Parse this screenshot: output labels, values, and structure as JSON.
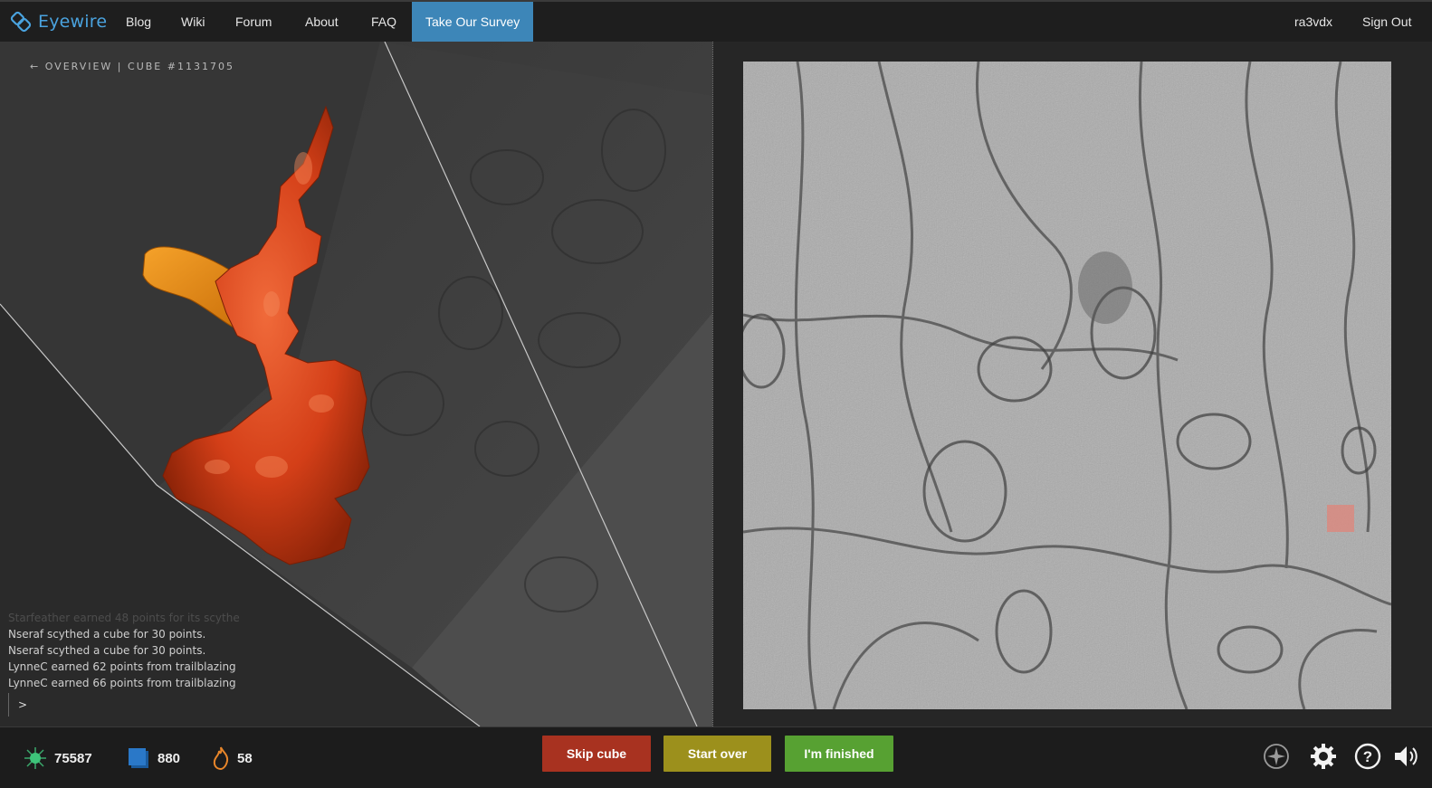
{
  "nav": {
    "logo_text": "Eyewire",
    "links": [
      "Blog",
      "Wiki",
      "Forum",
      "About",
      "FAQ",
      "Take Our Survey"
    ],
    "username": "ra3vdx",
    "signout": "Sign Out"
  },
  "viewer": {
    "back_arrow": "←",
    "overview": "OVERVIEW",
    "separator": "|",
    "cube_label": "CUBE #1131705"
  },
  "chat": {
    "faded_line": "Starfeather earned 48 points for its scythe",
    "messages": [
      "Nseraf scythed a cube for 30 points.",
      "Nseraf scythed a cube for 30 points.",
      "LynneC earned 62 points from trailblazing",
      "LynneC earned 66 points from trailblazing"
    ],
    "prompt": ">"
  },
  "stats": {
    "points": "75587",
    "cubes": "880",
    "streak": "58"
  },
  "buttons": {
    "skip": "Skip cube",
    "start_over": "Start over",
    "finish": "I'm finished"
  },
  "icons": {
    "points": "neuron-icon",
    "cubes": "cube-icon",
    "streak": "flame-icon",
    "compass": "compass-icon",
    "settings": "gear-icon",
    "help": "help-icon",
    "sound": "speaker-icon"
  },
  "colors": {
    "accent": "#3d86b8",
    "skip": "#a83220",
    "start_over": "#9c901c",
    "finish": "#57a132",
    "segment_main": "#d9431f",
    "segment_alt": "#e88a12"
  }
}
